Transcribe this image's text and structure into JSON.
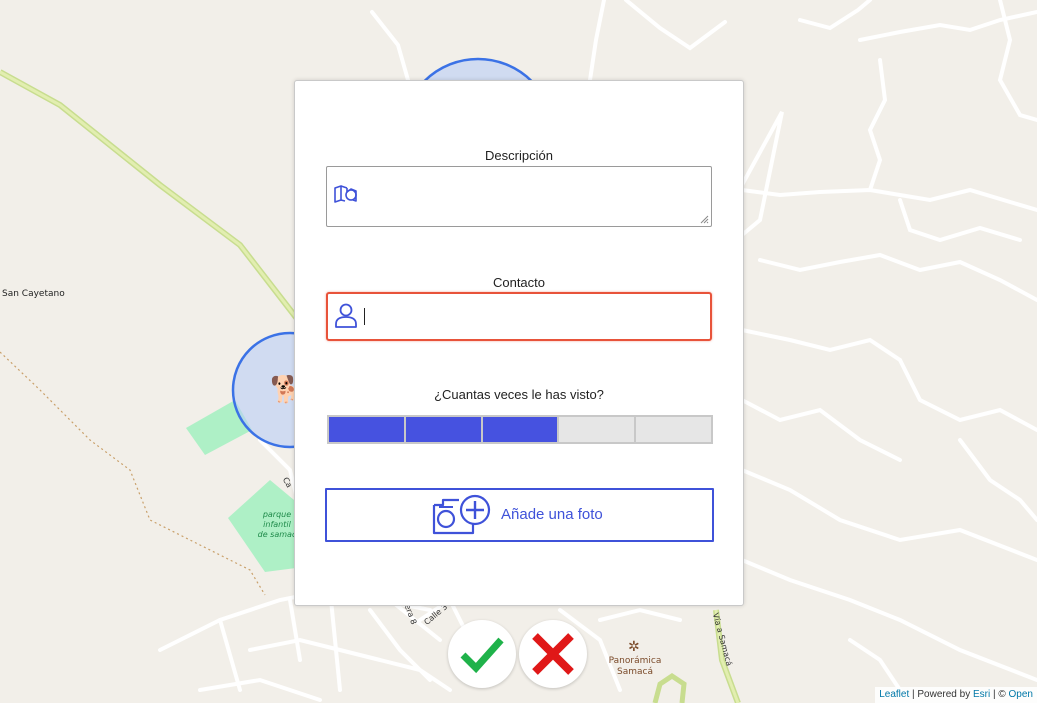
{
  "map": {
    "place_label": "San Cayetano",
    "park_label_lines": [
      "parque",
      "infantil",
      "de samac"
    ],
    "street_labels": [
      "Ca",
      "rrera 8",
      "Calle 3",
      "Vía a Samacá"
    ],
    "poi_lines": [
      "Panorámica",
      "Samacá"
    ],
    "marker_emoji": "🐕",
    "circle_color": "#3b72e6"
  },
  "form": {
    "description_label": "Descripción",
    "description_icon": "map-icon",
    "contact_label": "Contacto",
    "contact_icon": "user-icon",
    "contact_value": "",
    "sightings_label": "¿Cuantas veces le has visto?",
    "sightings_rating": 3,
    "sightings_max": 5,
    "photo_button_label": "Añade una foto",
    "photo_icon": "camera-plus-icon"
  },
  "actions": {
    "confirm_icon": "checkmark-icon",
    "cancel_icon": "x-icon"
  },
  "attribution": {
    "leaflet": "Leaflet",
    "sep1": " | Powered by ",
    "esri": "Esri",
    "sep2": " | © ",
    "osm": "Open"
  },
  "colors": {
    "accent": "#3f52d9",
    "rating_fill": "#4652e0",
    "error_border": "#e8533a",
    "confirm": "#1fb24a",
    "cancel": "#e01818"
  }
}
